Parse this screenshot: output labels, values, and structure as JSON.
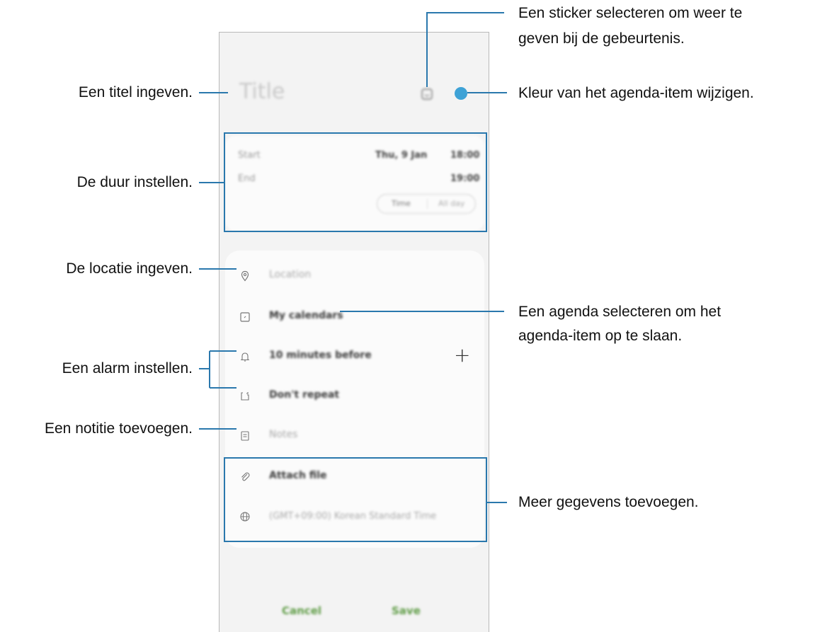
{
  "screen": {
    "title_placeholder": "Title",
    "date_card": {
      "start_label": "Start",
      "start_date": "Thu, 9 Jan",
      "start_time": "18:00",
      "end_label": "End",
      "end_time": "19:00",
      "toggle_time": "Time",
      "toggle_all_day": "All day"
    },
    "rows": {
      "location": "Location",
      "calendar": "My calendars",
      "alarm": "10 minutes before",
      "repeat": "Don't repeat",
      "notes": "Notes",
      "attach": "Attach file",
      "timezone": "(GMT+09:00) Korean Standard Time"
    },
    "actions": {
      "cancel": "Cancel",
      "save": "Save"
    },
    "event_color": "#3ea2d6"
  },
  "callouts": {
    "title": "Een titel ingeven.",
    "duration": "De duur instellen.",
    "location": "De locatie ingeven.",
    "alarm": "Een alarm instellen.",
    "note": "Een notitie toevoegen.",
    "sticker_line1": "Een sticker selecteren om weer te",
    "sticker_line2": "geven bij de gebeurtenis.",
    "color": "Kleur van het agenda-item wijzigen.",
    "calendar_line1": "Een agenda selecteren om het",
    "calendar_line2": "agenda-item op te slaan.",
    "more": "Meer gegevens toevoegen."
  },
  "accent_color": "#2a78ad"
}
